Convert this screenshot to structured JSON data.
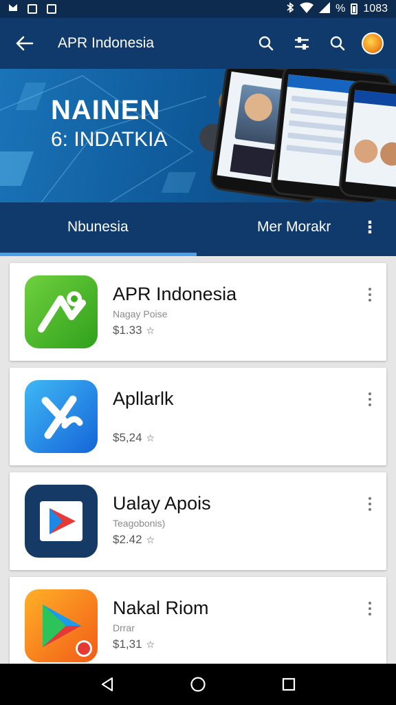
{
  "status_bar": {
    "battery_text": "%",
    "time": "1083"
  },
  "app_bar": {
    "title": "APR Indonesia"
  },
  "banner": {
    "headline": "NAINEN",
    "subheadline": "6: INDATKIA"
  },
  "tabs": [
    {
      "label": "Nbunesia",
      "selected": true
    },
    {
      "label": "Mer Morakr",
      "selected": false
    }
  ],
  "apps": [
    {
      "name": "APR Indonesia",
      "subtitle": "Nagay Poise",
      "price": "$1.33",
      "icon": "green-tile-icon"
    },
    {
      "name": "Apllarlk",
      "subtitle": "",
      "price": "$5,24",
      "icon": "blue-tile-icon"
    },
    {
      "name": "Ualay Apois",
      "subtitle": "Teagobonis)",
      "price": "$2.42",
      "icon": "play-triangle-icon"
    },
    {
      "name": "Nakal Riom",
      "subtitle": "Drrar",
      "price": "$1,31",
      "icon": "play-store-icon"
    }
  ],
  "colors": {
    "primary_dark": "#0f3a6b",
    "status_bar": "#0d2a4f",
    "accent": "#4a9fe8"
  }
}
